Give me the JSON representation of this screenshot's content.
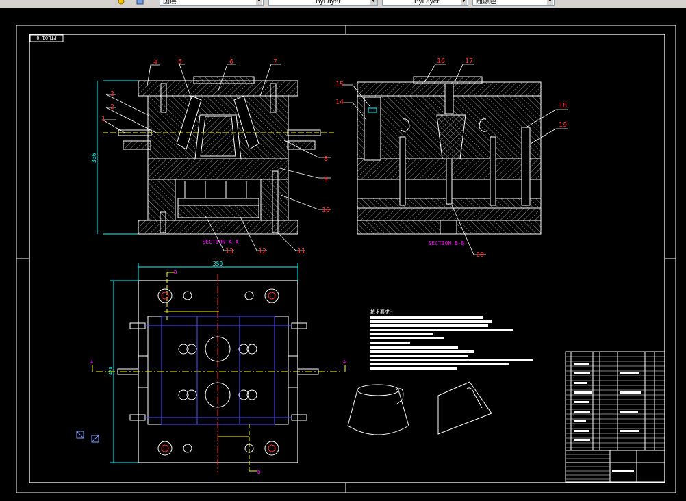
{
  "toolbar": {
    "layer_value": "图层",
    "linetype_value": "ByLayer",
    "lineweight_value": "ByLayer",
    "color_value": "随颜色"
  },
  "drawing": {
    "code": "PTL01-0",
    "section_a_label": "SECTION A-A",
    "section_b_label": "SECTION B-B",
    "dim_height": "336",
    "dim_width": "350",
    "dim_side": "400",
    "part_numbers": [
      "1",
      "2",
      "3",
      "4",
      "5",
      "6",
      "7",
      "8",
      "9",
      "10",
      "11",
      "12",
      "13",
      "14",
      "15",
      "16",
      "17",
      "18",
      "19",
      "20"
    ],
    "cut_label_a": "A",
    "cut_label_b": "B",
    "tech_req_title": "技术要求:",
    "colors": {
      "red": "#ff2a2a",
      "magenta": "#ff00ff",
      "cyan": "#00ffff",
      "yellow": "#ffff00",
      "white": "#ffffff",
      "blue": "#5050ff"
    }
  }
}
